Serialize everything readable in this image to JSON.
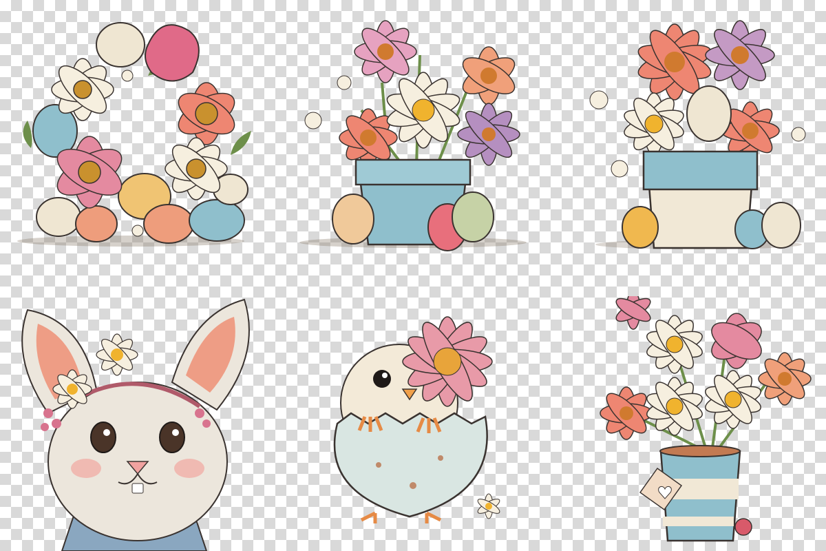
{
  "illustrations": [
    {
      "subject": "flower-and-egg-wreath"
    },
    {
      "subject": "daisy-pot-with-eggs"
    },
    {
      "subject": "flower-pot-with-eggs"
    },
    {
      "subject": "bunny-portrait"
    },
    {
      "subject": "chick-in-egg-with-flower"
    },
    {
      "subject": "daisy-bucket-with-tag"
    }
  ],
  "colors": {
    "checker_light": "#ffffff",
    "checker_dark": "#d9d9d9",
    "pink": "#e48aa0",
    "coral": "#ee8672",
    "cream": "#f6efdf",
    "teal": "#8fbfcc",
    "lilac": "#c49ac4",
    "egg_yellow": "#f0c473",
    "leaf": "#6d8f4a",
    "outline": "#3a3330"
  }
}
